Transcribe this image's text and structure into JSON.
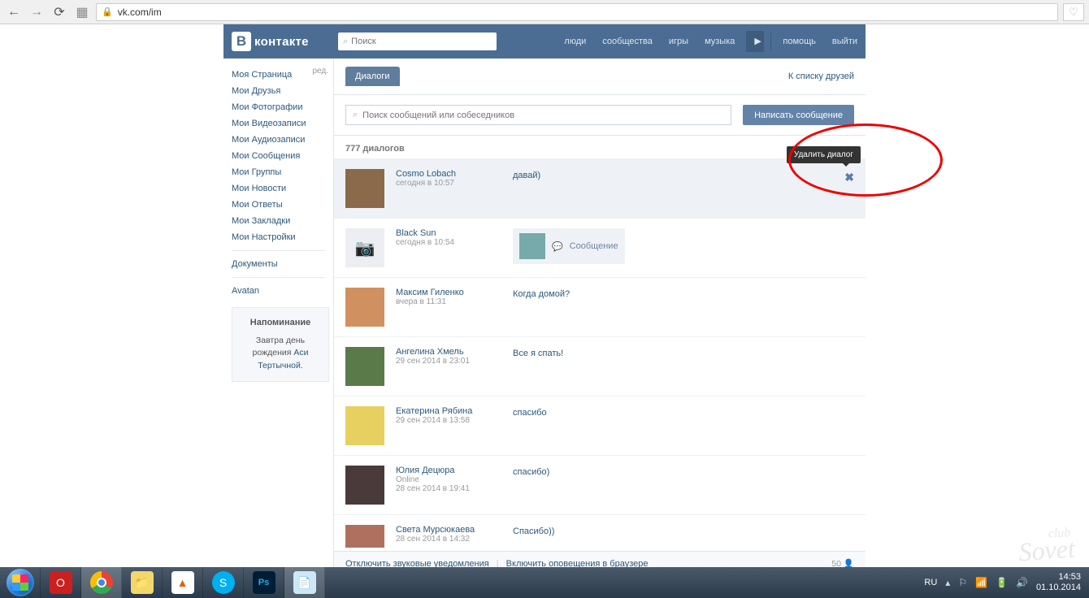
{
  "browser": {
    "url": "vk.com/im"
  },
  "header": {
    "logo_text": "контакте",
    "search_placeholder": "Поиск",
    "nav": [
      "люди",
      "сообщества",
      "игры",
      "музыка"
    ],
    "nav_right": [
      "помощь",
      "выйти"
    ]
  },
  "sidebar": {
    "items": [
      "Моя Страница",
      "Мои Друзья",
      "Мои Фотографии",
      "Мои Видеозаписи",
      "Мои Аудиозаписи",
      "Мои Сообщения",
      "Мои Группы",
      "Мои Новости",
      "Мои Ответы",
      "Мои Закладки",
      "Мои Настройки"
    ],
    "edit_label": "ред.",
    "extra": [
      "Документы",
      "Avatan"
    ],
    "reminder": {
      "title": "Напоминание",
      "line1": "Завтра ",
      "line2": "день рождения ",
      "link": "Аси Тертычной",
      "dot": "."
    }
  },
  "main": {
    "tab_label": "Диалоги",
    "friends_link": "К списку друзей",
    "search_placeholder": "Поиск сообщений или собеседников",
    "write_button": "Написать сообщение",
    "count_label": "777 диалогов",
    "tooltip": "Удалить диалог",
    "dialogs": [
      {
        "name": "Cosmo Lobach",
        "time": "сегодня в 10:57",
        "preview": "давай)"
      },
      {
        "name": "Black Sun",
        "time": "сегодня в 10:54",
        "preview": "Сообщение",
        "boxed": true
      },
      {
        "name": "Максим Гиленко",
        "time": "вчера в 11:31",
        "preview": "Когда домой?"
      },
      {
        "name": "Ангелина Хмель",
        "time": "29 сен 2014 в 23:01",
        "preview": "Все я спать!"
      },
      {
        "name": "Екатерина Рябина",
        "time": "29 сен 2014 в 13:58",
        "preview": "спасибо"
      },
      {
        "name": "Юлия Децюра",
        "online": "Online",
        "time": "28 сен 2014 в 19:41",
        "preview": "спасибо)"
      },
      {
        "name": "Света Мурсюкаева",
        "time": "28 сен 2014 в 14:32",
        "preview": "Спасибо))"
      }
    ],
    "footer": {
      "mute": "Отключить звуковые уведомления",
      "browser_notif": "Включить оповещения в браузере",
      "count_right": "50"
    }
  },
  "tray": {
    "lang": "RU",
    "time": "14:53",
    "date": "01.10.2014"
  },
  "watermark": {
    "small": "club",
    "big": "Sovet"
  }
}
